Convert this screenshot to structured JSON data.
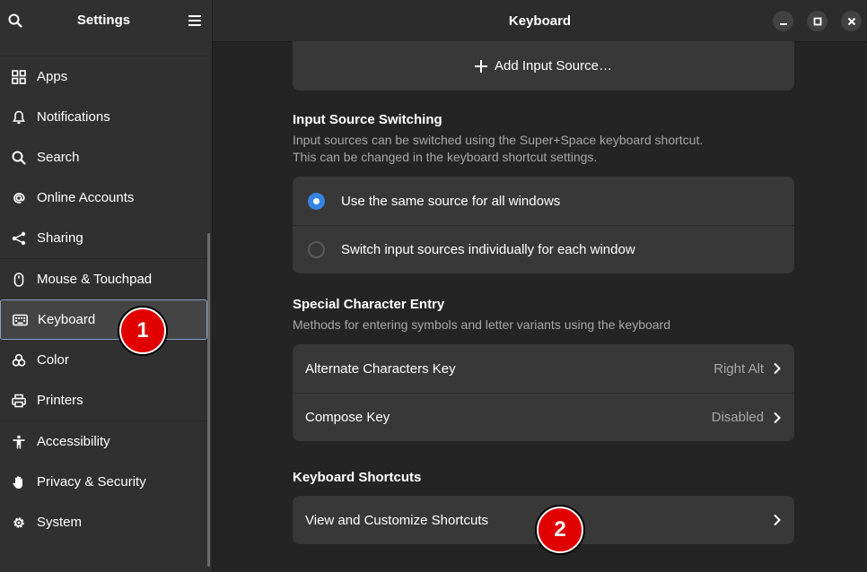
{
  "sidebar": {
    "title": "Settings",
    "groups": [
      [
        {
          "label": "Apps",
          "icon": "apps-icon"
        },
        {
          "label": "Notifications",
          "icon": "bell-icon"
        },
        {
          "label": "Search",
          "icon": "search-icon"
        },
        {
          "label": "Online Accounts",
          "icon": "at-icon"
        },
        {
          "label": "Sharing",
          "icon": "share-icon"
        }
      ],
      [
        {
          "label": "Mouse & Touchpad",
          "icon": "mouse-icon"
        },
        {
          "label": "Keyboard",
          "icon": "keyboard-icon",
          "active": true
        },
        {
          "label": "Color",
          "icon": "color-icon"
        },
        {
          "label": "Printers",
          "icon": "printer-icon"
        }
      ],
      [
        {
          "label": "Accessibility",
          "icon": "accessibility-icon"
        },
        {
          "label": "Privacy & Security",
          "icon": "hand-icon"
        },
        {
          "label": "System",
          "icon": "gear-icon"
        }
      ]
    ]
  },
  "main": {
    "title": "Keyboard",
    "add_input_source": "Add Input Source…",
    "switching": {
      "title": "Input Source Switching",
      "desc_line1": "Input sources can be switched using the Super+Space keyboard shortcut.",
      "desc_line2": "This can be changed in the keyboard shortcut settings.",
      "option_same": "Use the same source for all windows",
      "option_individual": "Switch input sources individually for each window"
    },
    "special": {
      "title": "Special Character Entry",
      "desc": "Methods for entering symbols and letter variants using the keyboard",
      "alt_label": "Alternate Characters Key",
      "alt_value": "Right Alt",
      "compose_label": "Compose Key",
      "compose_value": "Disabled"
    },
    "shortcuts": {
      "title": "Keyboard Shortcuts",
      "view_label": "View and Customize Shortcuts"
    }
  },
  "annotations": {
    "badge1": "1",
    "badge2": "2"
  },
  "colors": {
    "accent": "#3584e4",
    "badge": "#e00000"
  }
}
